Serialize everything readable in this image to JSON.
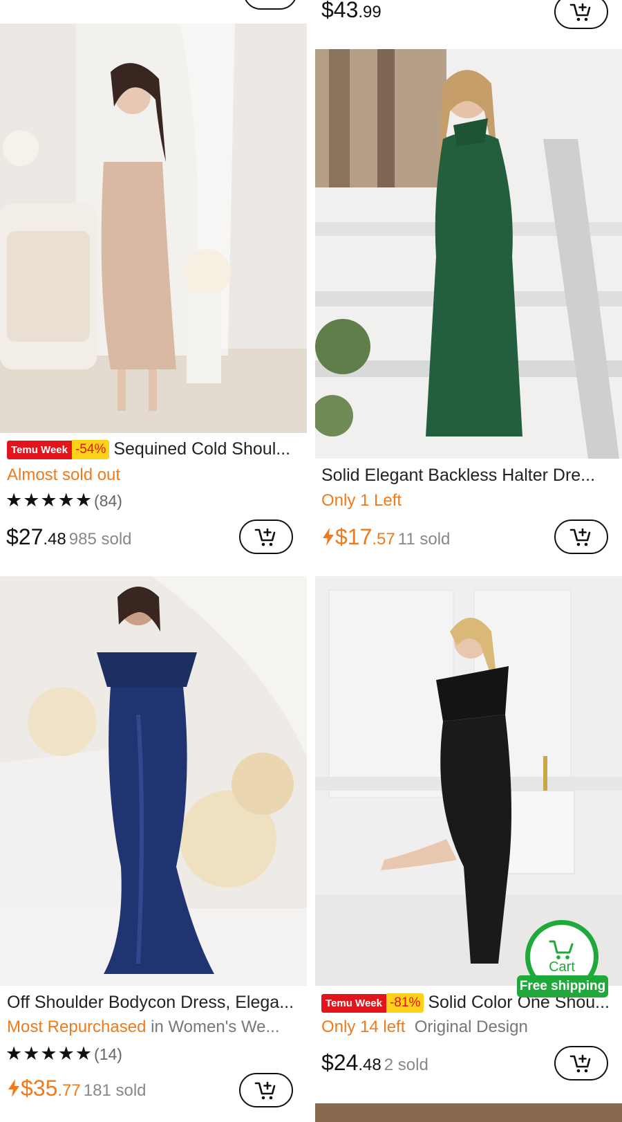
{
  "top_price": {
    "dollar": "$43",
    "cents": ".99"
  },
  "products": [
    {
      "badge": "Temu Week",
      "discount": "-54%",
      "title": "Sequined Cold Shoul...",
      "tag": "Almost sold out",
      "rating_count": "(84)",
      "price_dollar": "$27",
      "price_cents": ".48",
      "sold": "985 sold"
    },
    {
      "title": "Solid Elegant Backless Halter Dre...",
      "tag": "Only 1 Left",
      "price_dollar": "$17",
      "price_cents": ".57",
      "sold": "11 sold"
    },
    {
      "title": "Off Shoulder Bodycon Dress, Elega...",
      "tag": "Most Repurchased",
      "tag_suffix": "in Women's We...",
      "rating_count": "(14)",
      "price_dollar": "$35",
      "price_cents": ".77",
      "sold": "181 sold"
    },
    {
      "badge": "Temu Week",
      "discount": "-81%",
      "title": "Solid Color One Shou...",
      "tag": "Only 14 left",
      "tag_suffix": "Original Design",
      "price_dollar": "$24",
      "price_cents": ".48",
      "sold": "2 sold"
    }
  ],
  "floating_cart": {
    "label": "Cart",
    "shipping": "Free shipping"
  },
  "colors": {
    "accent_orange": "#f07a1a",
    "cart_green": "#1fa93a",
    "badge_red": "#e3141b",
    "discount_yellow": "#ffd21a"
  },
  "icons": [
    "add-to-cart-icon",
    "star-icon",
    "lightning-icon",
    "cart-icon"
  ]
}
